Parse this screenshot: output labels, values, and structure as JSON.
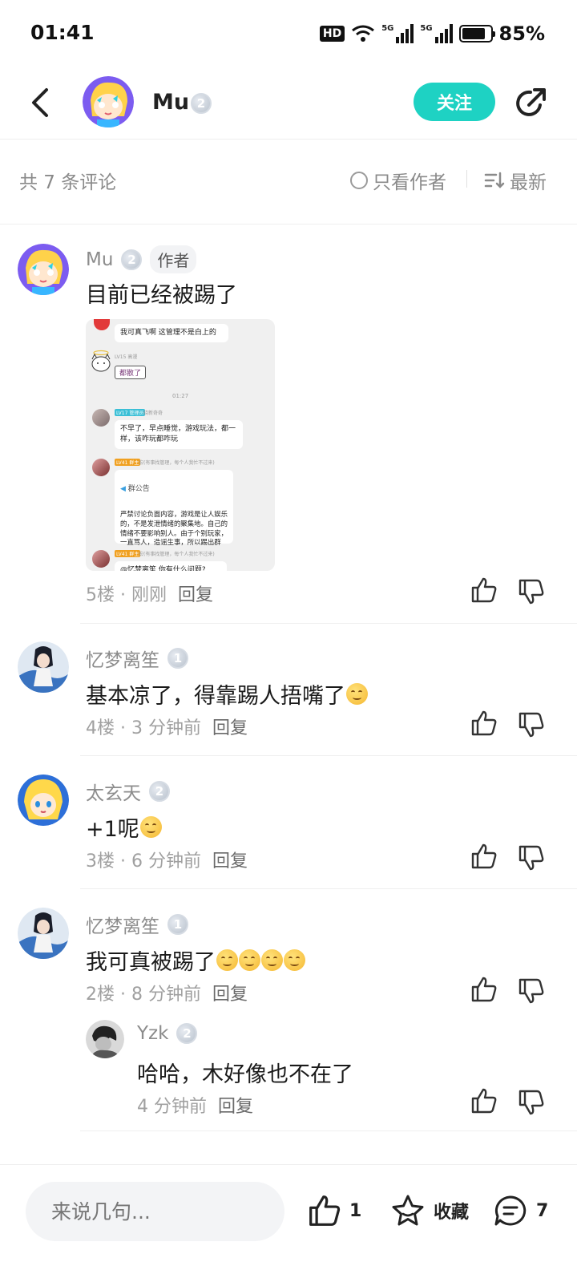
{
  "status_bar": {
    "time": "01:41",
    "hd": "HD",
    "net1": "5G",
    "net2": "5G",
    "battery_pct": "85%",
    "battery_level": 0.85
  },
  "header": {
    "author_name": "Mu",
    "level": "2",
    "follow_label": "关注"
  },
  "comments_header": {
    "count_label": "共 7 条评论",
    "only_author_label": "只看作者",
    "sort_label": "最新"
  },
  "comments": [
    {
      "user": "Mu",
      "level": "2",
      "tag": "作者",
      "text": "目前已经被踢了",
      "floor": "5楼 · 刚刚",
      "reply": "回复"
    },
    {
      "user": "忆梦离笙",
      "level": "1",
      "text": "基本凉了，得靠踢人捂嘴了",
      "floor": "4楼 · 3 分钟前",
      "reply": "回复"
    },
    {
      "user": "太玄天",
      "level": "2",
      "text": "+1呢",
      "floor": "3楼 · 6 分钟前",
      "reply": "回复"
    },
    {
      "user": "忆梦离笙",
      "level": "1",
      "text": "我可真被踢了",
      "floor": "2楼 · 8 分钟前",
      "reply": "回复"
    }
  ],
  "reply": {
    "user": "Yzk",
    "level": "2",
    "text": "哈哈，木好像也不在了",
    "time": "4 分钟前",
    "reply": "回复"
  },
  "screenshot": {
    "msg1": "我可真飞啊 这管理不是白上的",
    "lv_a": "LV15 高漫",
    "sticker": "都散了",
    "time": "01:27",
    "lv_b": "LV17 管理员",
    "name_b": "晓新奇奇",
    "msg2": "不早了，早点睡觉，游戏玩法，都一样，该咋玩都咋玩",
    "lv_c": "LV41 群主",
    "name_c": "宏(有事找管理，每个人我忙不过来)",
    "notice_title": "群公告",
    "notice_body": "严禁讨论负面内容，游戏是让人娱乐的，不是发泄情绪的聚集地。自己的情绪不要影响别人。由于个别玩家，一直骂人，造谣生事，所以踢出群",
    "lv_d": "LV41 群主",
    "name_d": "宏(有事找管理，每个人我忙不过来)",
    "msg3": "@忆梦离笙 你有什么问题?"
  },
  "bottom_bar": {
    "input_placeholder": "来说几句...",
    "like_count": "1",
    "fav_label": "收藏",
    "comment_count": "7"
  },
  "colors": {
    "accent": "#1ed2c3",
    "text_gray": "#8c8c8c"
  }
}
